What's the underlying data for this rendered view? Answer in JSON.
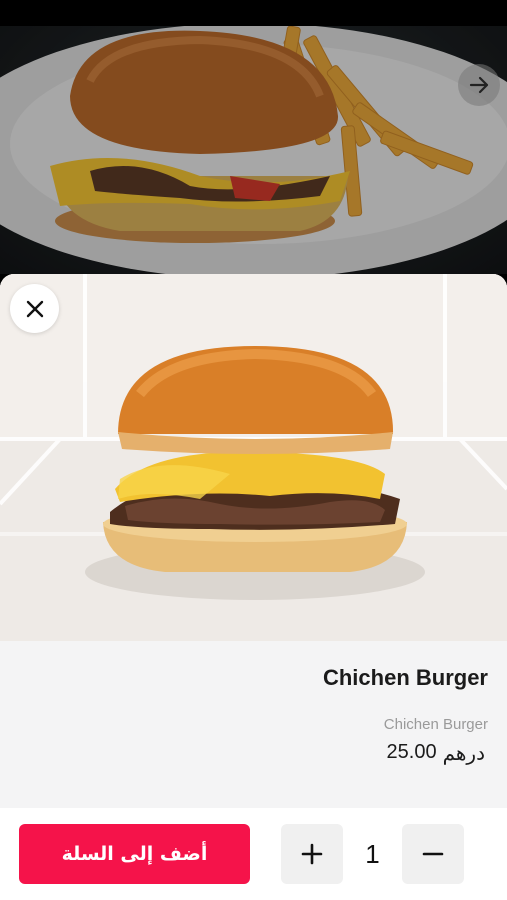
{
  "product": {
    "title": "Chichen Burger",
    "subtitle": "Chichen Burger",
    "price_value": "25.00",
    "price_currency": "درهم"
  },
  "cart": {
    "add_label": "أضف إلى السلة",
    "quantity": "1"
  },
  "icons": {
    "next": "arrow-right-icon",
    "close": "close-icon",
    "plus": "plus-icon",
    "minus": "minus-icon"
  },
  "colors": {
    "accent": "#f5134a",
    "sheet_bg": "#f4f4f5",
    "button_gray": "#f0f0f0"
  }
}
